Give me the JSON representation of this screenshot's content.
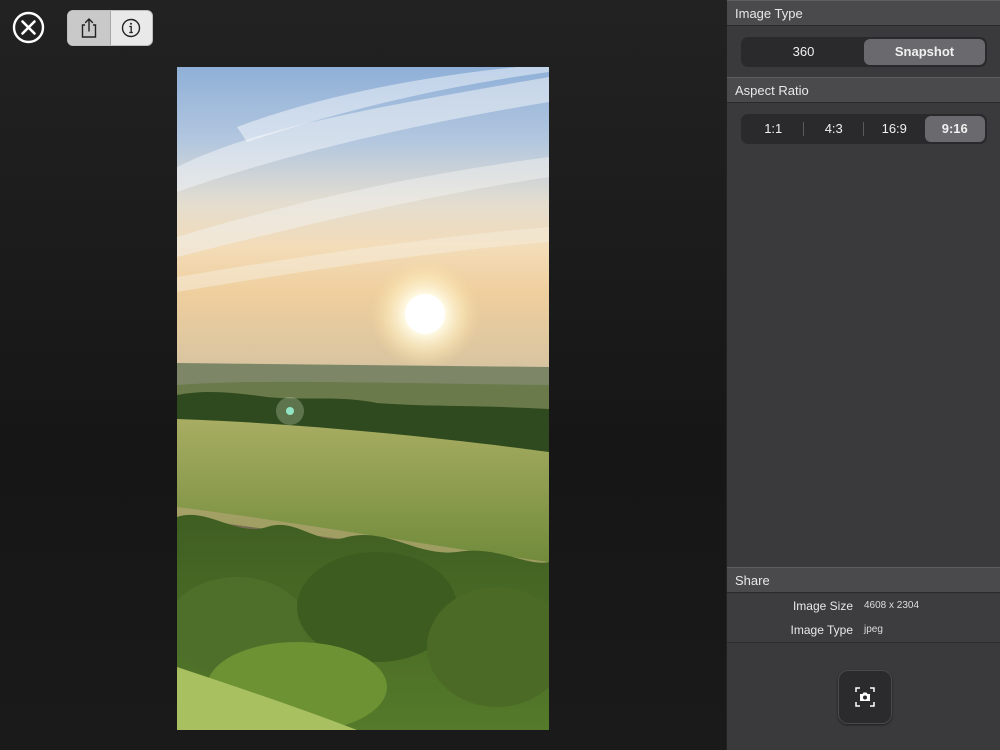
{
  "toolbar": {
    "close_icon": "close-circle-icon",
    "share_icon": "share-icon",
    "info_icon": "info-icon"
  },
  "image_type": {
    "header": "Image Type",
    "options": [
      "360",
      "Snapshot"
    ],
    "selected": "Snapshot"
  },
  "aspect_ratio": {
    "header": "Aspect Ratio",
    "options": [
      "1:1",
      "4:3",
      "16:9",
      "9:16"
    ],
    "selected": "9:16"
  },
  "share": {
    "header": "Share",
    "rows": [
      {
        "label": "Image Size",
        "value": "4608 x 2304"
      },
      {
        "label": "Image Type",
        "value": "jpeg"
      }
    ],
    "capture_icon": "camera-capture-icon"
  },
  "colors": {
    "panel_bg": "#3a3a3c",
    "header_bg": "#4a4a4c",
    "selected_segment": "#6a6a6e"
  }
}
